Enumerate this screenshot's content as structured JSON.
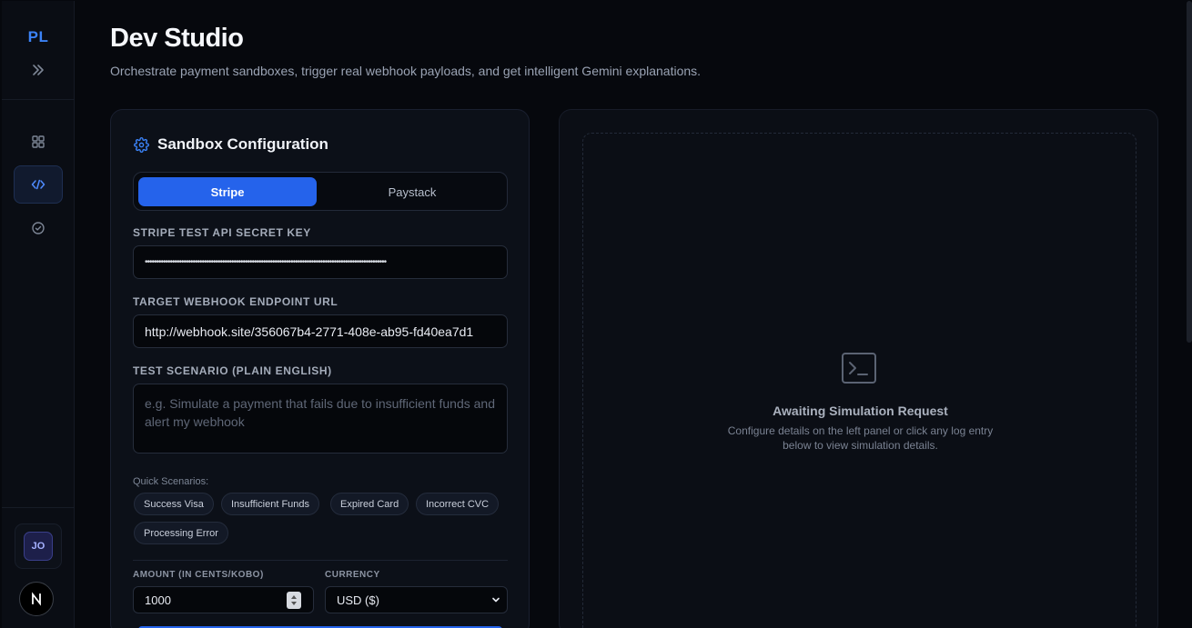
{
  "sidebar": {
    "logo": "PL",
    "avatar_initials": "JO",
    "brand_letter": "N"
  },
  "header": {
    "title": "Dev Studio",
    "subtitle": "Orchestrate payment sandboxes, trigger real webhook payloads, and get intelligent Gemini explanations."
  },
  "config": {
    "title": "Sandbox Configuration",
    "providers": [
      "Stripe",
      "Paystack"
    ],
    "selected_provider": "Stripe",
    "api_key_label": "STRIPE TEST API SECRET KEY",
    "api_key_value": "••••••••••••••••••••••••••••••••••••••••••••••••••••••••••••••••••••••••••••••••••••••••••••••••••••••••••",
    "webhook_label": "TARGET WEBHOOK ENDPOINT URL",
    "webhook_value": "http://webhook.site/356067b4-2771-408e-ab95-fd40ea7d1",
    "scenario_label": "TEST SCENARIO (PLAIN ENGLISH)",
    "scenario_placeholder": "e.g. Simulate a payment that fails due to insufficient funds and alert my webhook",
    "quick_label": "Quick Scenarios:",
    "quick_scenarios": [
      "Success Visa",
      "Insufficient Funds",
      "Expired Card",
      "Incorrect CVC",
      "Processing Error"
    ],
    "amount_label": "AMOUNT (IN CENTS/KOBO)",
    "amount_value": "1000",
    "currency_label": "CURRENCY",
    "currency_value": "USD ($)"
  },
  "output": {
    "title": "Awaiting Simulation Request",
    "description": "Configure details on the left panel or click any log entry below to view simulation details."
  },
  "colors": {
    "accent": "#2563eb",
    "logo": "#3b82f6",
    "background": "#06080d"
  }
}
